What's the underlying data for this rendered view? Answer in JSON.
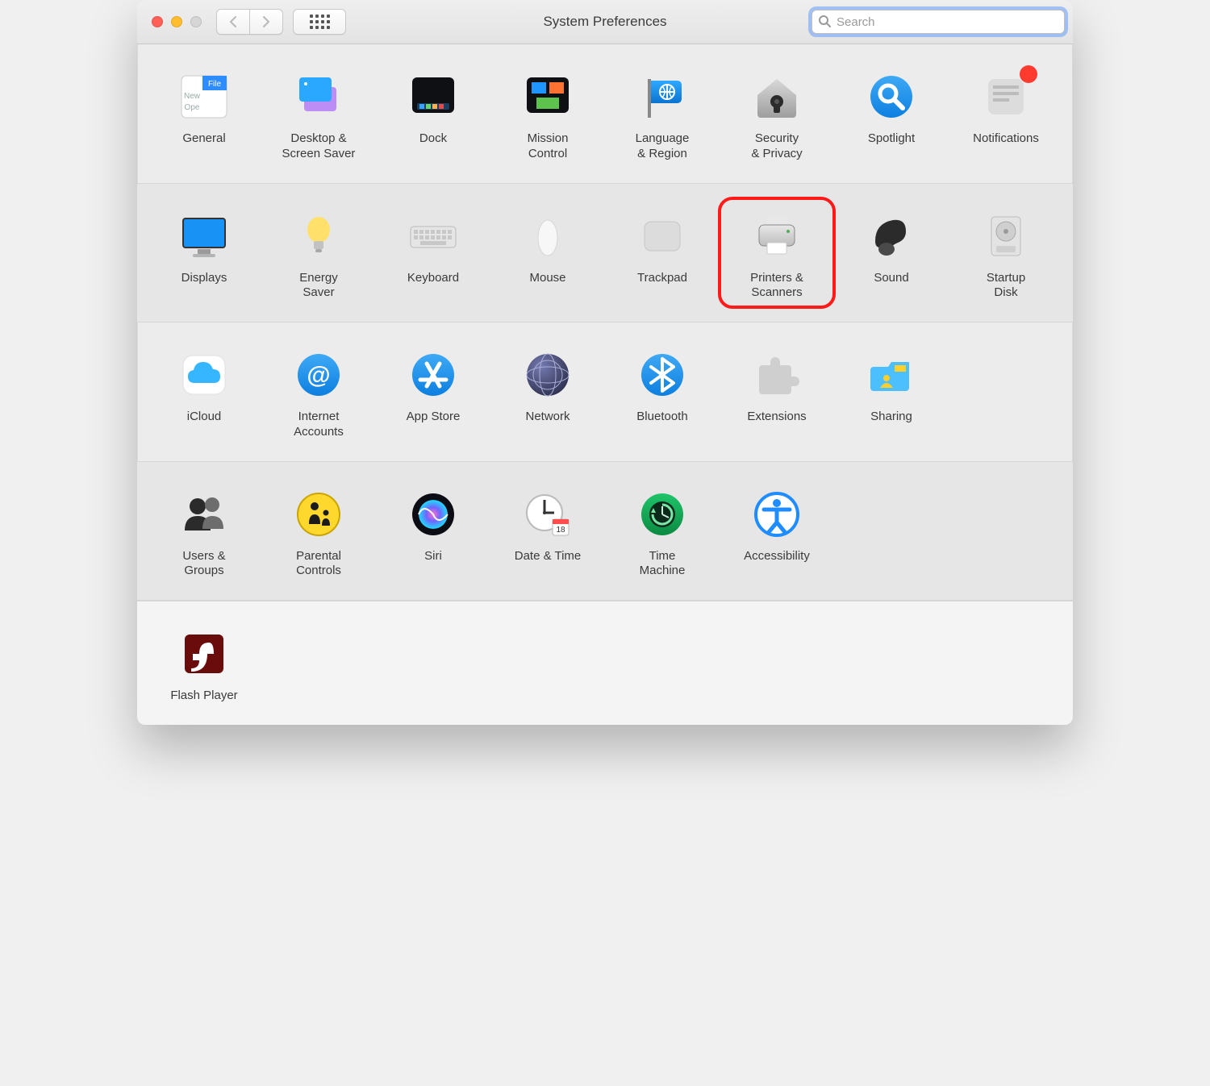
{
  "window": {
    "title": "System Preferences"
  },
  "search": {
    "placeholder": "Search",
    "value": ""
  },
  "rows": [
    {
      "alt": false,
      "items": [
        {
          "key": "general",
          "label": "General"
        },
        {
          "key": "desktop",
          "label": "Desktop &\nScreen Saver"
        },
        {
          "key": "dock",
          "label": "Dock"
        },
        {
          "key": "mission",
          "label": "Mission\nControl"
        },
        {
          "key": "language",
          "label": "Language\n& Region"
        },
        {
          "key": "security",
          "label": "Security\n& Privacy"
        },
        {
          "key": "spotlight",
          "label": "Spotlight"
        },
        {
          "key": "notifications",
          "label": "Notifications",
          "badge": true
        }
      ]
    },
    {
      "alt": true,
      "items": [
        {
          "key": "displays",
          "label": "Displays"
        },
        {
          "key": "energy",
          "label": "Energy\nSaver"
        },
        {
          "key": "keyboard",
          "label": "Keyboard"
        },
        {
          "key": "mouse",
          "label": "Mouse"
        },
        {
          "key": "trackpad",
          "label": "Trackpad"
        },
        {
          "key": "printers",
          "label": "Printers &\nScanners",
          "highlight": true
        },
        {
          "key": "sound",
          "label": "Sound"
        },
        {
          "key": "startup",
          "label": "Startup\nDisk"
        }
      ]
    },
    {
      "alt": false,
      "items": [
        {
          "key": "icloud",
          "label": "iCloud"
        },
        {
          "key": "internet",
          "label": "Internet\nAccounts"
        },
        {
          "key": "appstore",
          "label": "App Store"
        },
        {
          "key": "network",
          "label": "Network"
        },
        {
          "key": "bluetooth",
          "label": "Bluetooth"
        },
        {
          "key": "extensions",
          "label": "Extensions"
        },
        {
          "key": "sharing",
          "label": "Sharing"
        }
      ]
    },
    {
      "alt": true,
      "items": [
        {
          "key": "users",
          "label": "Users &\nGroups"
        },
        {
          "key": "parental",
          "label": "Parental\nControls"
        },
        {
          "key": "siri",
          "label": "Siri"
        },
        {
          "key": "datetime",
          "label": "Date & Time"
        },
        {
          "key": "timemachine",
          "label": "Time\nMachine"
        },
        {
          "key": "accessibility",
          "label": "Accessibility"
        }
      ]
    },
    {
      "alt": false,
      "last": true,
      "items": [
        {
          "key": "flash",
          "label": "Flash Player"
        }
      ]
    }
  ]
}
